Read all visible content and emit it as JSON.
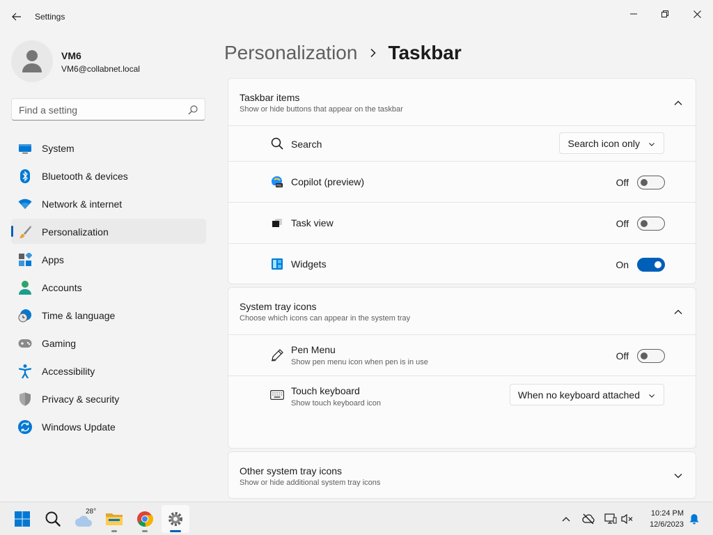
{
  "window": {
    "title": "Settings"
  },
  "profile": {
    "name": "VM6",
    "email": "VM6@collabnet.local"
  },
  "search": {
    "placeholder": "Find a setting"
  },
  "nav": {
    "items": [
      {
        "label": "System",
        "icon": "system-icon"
      },
      {
        "label": "Bluetooth & devices",
        "icon": "bluetooth-icon"
      },
      {
        "label": "Network & internet",
        "icon": "wifi-icon"
      },
      {
        "label": "Personalization",
        "icon": "paintbrush-icon",
        "active": true
      },
      {
        "label": "Apps",
        "icon": "apps-icon"
      },
      {
        "label": "Accounts",
        "icon": "accounts-icon"
      },
      {
        "label": "Time & language",
        "icon": "time-language-icon"
      },
      {
        "label": "Gaming",
        "icon": "gamepad-icon"
      },
      {
        "label": "Accessibility",
        "icon": "accessibility-icon"
      },
      {
        "label": "Privacy & security",
        "icon": "shield-icon"
      },
      {
        "label": "Windows Update",
        "icon": "windows-update-icon"
      }
    ]
  },
  "breadcrumb": {
    "parent": "Personalization",
    "current": "Taskbar"
  },
  "taskbar_items": {
    "title": "Taskbar items",
    "subtitle": "Show or hide buttons that appear on the taskbar",
    "search": {
      "label": "Search",
      "value": "Search icon only"
    },
    "copilot": {
      "label": "Copilot (preview)",
      "state": "Off",
      "on": false
    },
    "taskview": {
      "label": "Task view",
      "state": "Off",
      "on": false
    },
    "widgets": {
      "label": "Widgets",
      "state": "On",
      "on": true
    }
  },
  "system_tray": {
    "title": "System tray icons",
    "subtitle": "Choose which icons can appear in the system tray",
    "pen": {
      "label": "Pen Menu",
      "sub": "Show pen menu icon when pen is in use",
      "state": "Off",
      "on": false
    },
    "touch": {
      "label": "Touch keyboard",
      "sub": "Show touch keyboard icon",
      "value": "When no keyboard attached"
    }
  },
  "other_tray": {
    "title": "Other system tray icons",
    "subtitle": "Show or hide additional system tray icons"
  },
  "taskbar": {
    "weather_temp": "28°",
    "time": "10:24 PM",
    "date": "12/6/2023"
  },
  "colors": {
    "accent": "#005fb8",
    "background": "#f3f3f3",
    "card": "#fbfbfb"
  }
}
